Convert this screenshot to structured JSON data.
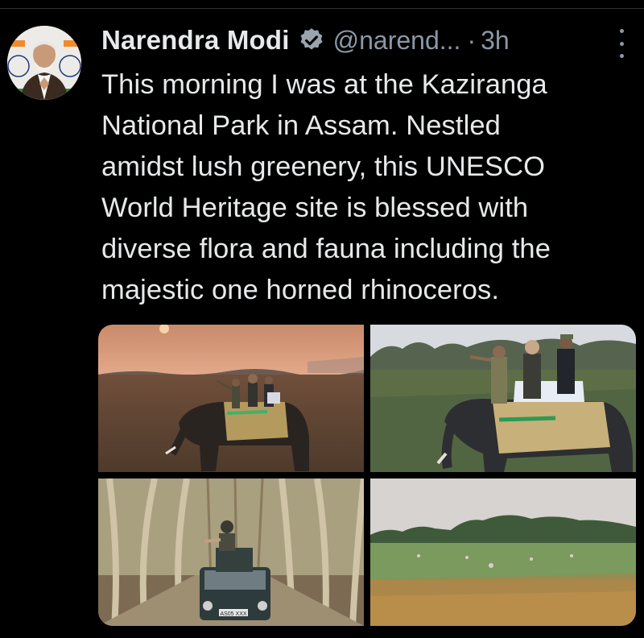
{
  "tweet": {
    "author_name": "Narendra Modi",
    "handle": "@narend...",
    "separator": "·",
    "time": "3h",
    "verified": true,
    "text_lines": [
      "This morning I was at the Kaziranga",
      "National Park in Assam. Nestled",
      "amidst lush greenery, this UNESCO",
      "World Heritage site is blessed with",
      "diverse flora and fauna including the",
      "majestic one horned rhinoceros."
    ]
  },
  "media": {
    "count": 4,
    "license_plate": "AS05 XXX"
  },
  "icons": {
    "verified": "verified-badge-icon",
    "more": "more-options-icon"
  },
  "colors": {
    "background": "#000000",
    "text": "#e7e9ea",
    "secondary": "#8b98a5",
    "verified_badge": "#9aa4ae"
  }
}
